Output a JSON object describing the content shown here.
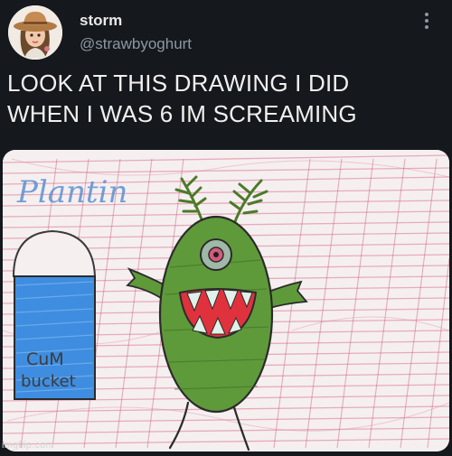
{
  "user": {
    "display_name": "storm",
    "handle": "@strawbyoghurt",
    "avatar": "avatar-cowgirl-illustration"
  },
  "tweet": {
    "text_lines": [
      "LOOK AT THIS DRAWING I DID",
      "WHEN I WAS 6 IM SCREAMING"
    ]
  },
  "media": {
    "type": "childs-crayon-drawing",
    "drawing_labels": {
      "title": "Plantin",
      "bucket_line1": "CuM",
      "bucket_line2": "bucket"
    }
  },
  "icons": {
    "more": "more-vertical-icon"
  },
  "watermark": "imgflip.com",
  "colors": {
    "background": "#15181c",
    "handle": "#8b98a5",
    "crayon_pink": "#d9748f",
    "crayon_blue": "#3f8de0",
    "plankton_green": "#5f9a3a"
  }
}
